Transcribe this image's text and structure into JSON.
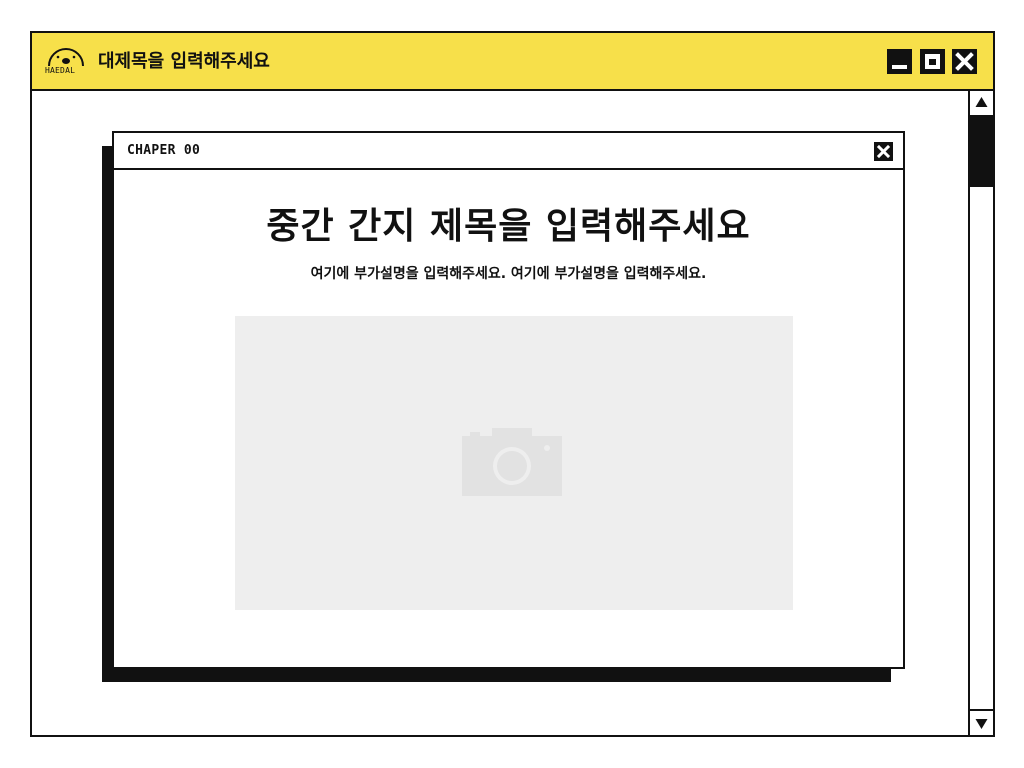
{
  "window": {
    "title": "대제목을 입력해주세요",
    "logo_text": "HAEDAL",
    "logo_icon": "haedal-logo-icon",
    "accent_color": "#f7e04a",
    "buttons": {
      "minimize": "minimize-icon",
      "maximize": "maximize-icon",
      "close": "close-icon"
    }
  },
  "scrollbar": {
    "up": "arrow-up-icon",
    "down": "arrow-down-icon"
  },
  "dialog": {
    "chapter_label": "CHAPER 00",
    "close_icon": "close-icon",
    "heading": "중간 간지 제목을 입력해주세요",
    "description": "여기에 부가설명을 입력해주세요. 여기에 부가설명을 입력해주세요.",
    "image_placeholder_icon": "camera-icon",
    "placeholder_color": "#eeeeee"
  }
}
